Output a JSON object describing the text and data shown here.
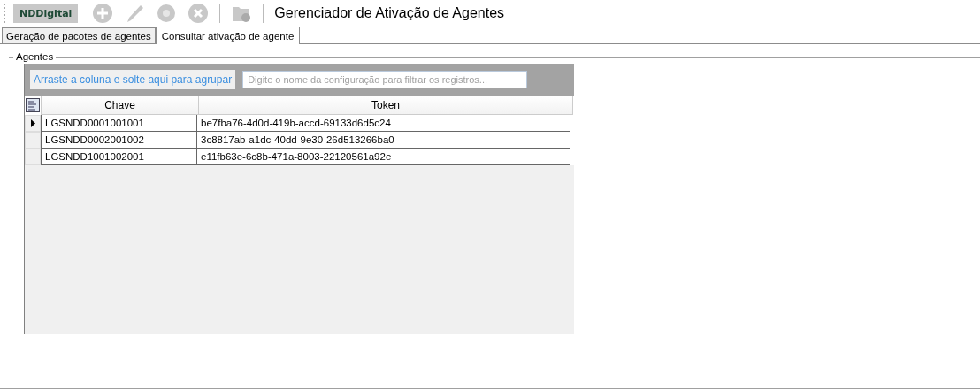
{
  "toolbar": {
    "logo": "NDDigital",
    "title": "Gerenciador de Ativação de Agentes",
    "buttons": [
      {
        "kind": "add",
        "disabled": true
      },
      {
        "kind": "edit",
        "disabled": true
      },
      {
        "kind": "settings",
        "disabled": true
      },
      {
        "kind": "remove",
        "disabled": true
      },
      {
        "kind": "export",
        "disabled": true
      }
    ]
  },
  "tabs": [
    {
      "label": "Geração de pacotes de agentes",
      "selected": false
    },
    {
      "label": "Consultar ativação de agente",
      "selected": true
    }
  ],
  "group": {
    "title": "Agentes"
  },
  "grid": {
    "group_panel": "Arraste a coluna e solte aqui para agrupar",
    "filter": {
      "placeholder": "Digite o nome da configuração para filtrar os registros..."
    },
    "columns": [
      "Chave",
      "Token"
    ],
    "rows": [
      {
        "selected": true,
        "cells": [
          "LGSNDD0001001001",
          "be7fba76-4d0d-419b-accd-69133d6d5c24"
        ]
      },
      {
        "selected": false,
        "cells": [
          "LGSNDD0002001002",
          "3c8817ab-a1dc-40dd-9e30-26d513266ba0"
        ]
      },
      {
        "selected": false,
        "cells": [
          "LGSNDD1001002001",
          "e11fb63e-6c8b-471a-8003-22120561a92e"
        ]
      }
    ]
  }
}
